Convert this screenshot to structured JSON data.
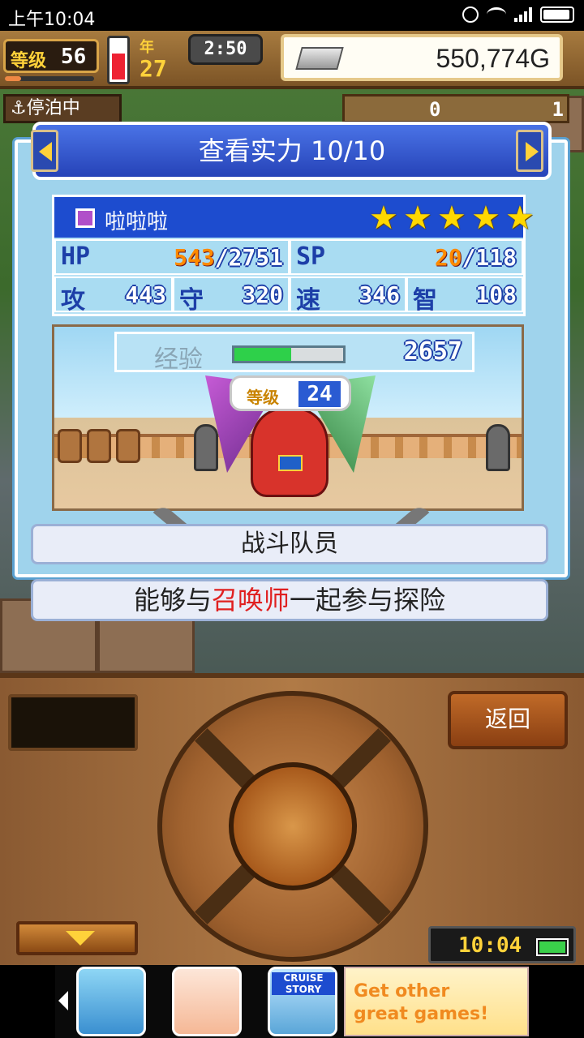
{
  "status": {
    "time": "上午10:04"
  },
  "hud": {
    "level_label": "等级",
    "level": "56",
    "level_progress": 0.18,
    "stamina_fill": 0.6,
    "year_label": "年",
    "year": "27",
    "clock": "2:50",
    "gold": "550,774G"
  },
  "row2": {
    "tab_label": "停泊中",
    "count_a": "0",
    "count_b": "1"
  },
  "dialog": {
    "title": "查看实力 10/10",
    "character": {
      "name": "啦啦啦",
      "stars": [
        "★",
        "★",
        "★",
        "★",
        "★"
      ],
      "hp_label": "HP",
      "hp_current": "543",
      "hp_max": "/2751",
      "sp_label": "SP",
      "sp_current": "20",
      "sp_max": "/118",
      "atk_label": "攻",
      "atk": "443",
      "def_label": "守",
      "def": "320",
      "spd_label": "速",
      "spd": "346",
      "int_label": "智",
      "int": "108",
      "exp_label": "经验",
      "exp_progress": 0.52,
      "exp": "2657",
      "level_label": "等级",
      "level": "24"
    },
    "role": "战斗队员",
    "desc_pre": "能够与",
    "desc_highlight": "召唤师",
    "desc_post": "一起参与探险"
  },
  "panel": {
    "back_label": "返回",
    "game_time": "10:04"
  },
  "ad": {
    "thumb3_label": "CRUISE STORY",
    "cta_line1": "Get other",
    "cta_line2": "great games!"
  },
  "colors": {
    "title_blue": "#2643b8",
    "highlight_red": "#e02020",
    "star_yellow": "#ffd800",
    "gold_text": "#ffd23a"
  }
}
